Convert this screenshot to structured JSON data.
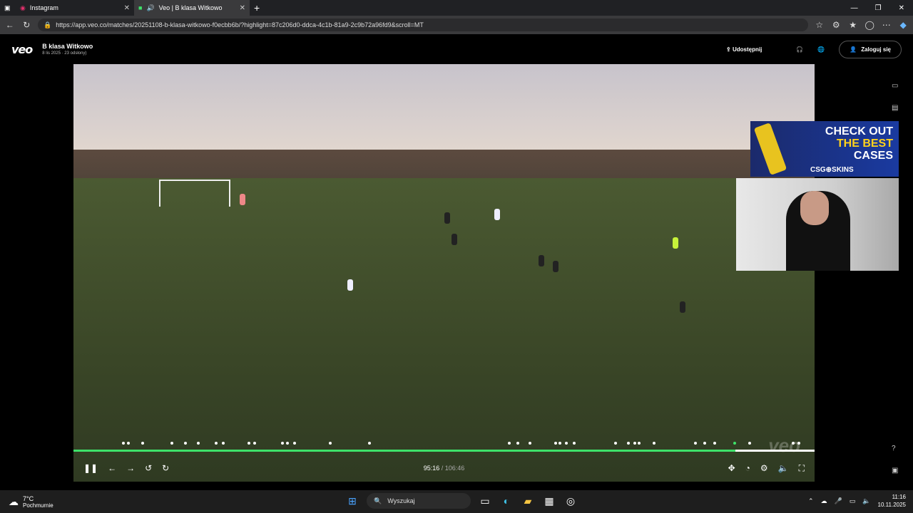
{
  "browser": {
    "tabs": [
      {
        "label": "Instagram",
        "active": false
      },
      {
        "label": "Veo | B klasa Witkowo",
        "active": true
      }
    ],
    "url": "https://app.veo.co/matches/20251108-b-klasa-witkowo-f0ecbb6b/?highlight=87c206d0-ddca-4c1b-81a9-2c9b72a96fd9&scroll=MT"
  },
  "header": {
    "logo": "veo",
    "match_title": "B klasa Witkowo",
    "match_subtitle": "8 lis 2025 · 23 odsłony)",
    "share_label": "Udostępnij",
    "login_label": "Zaloguj się"
  },
  "player": {
    "current_time": "95:16",
    "total_time": "/ 106:46",
    "progress": 0.893,
    "watermark": "veo"
  },
  "overlay_ad": {
    "line1": "CHECK OUT",
    "line2": "THE BEST",
    "line3": "CASES",
    "brand": "CSG⊕SKINS"
  },
  "taskbar": {
    "temperature": "7°C",
    "condition": "Pochmurnie",
    "search_placeholder": "Wyszukaj",
    "time": "11:16",
    "date": "10.11.2025"
  },
  "colors": {
    "progress_played": "#3ee26a",
    "ad_highlight": "#ffd21c"
  }
}
